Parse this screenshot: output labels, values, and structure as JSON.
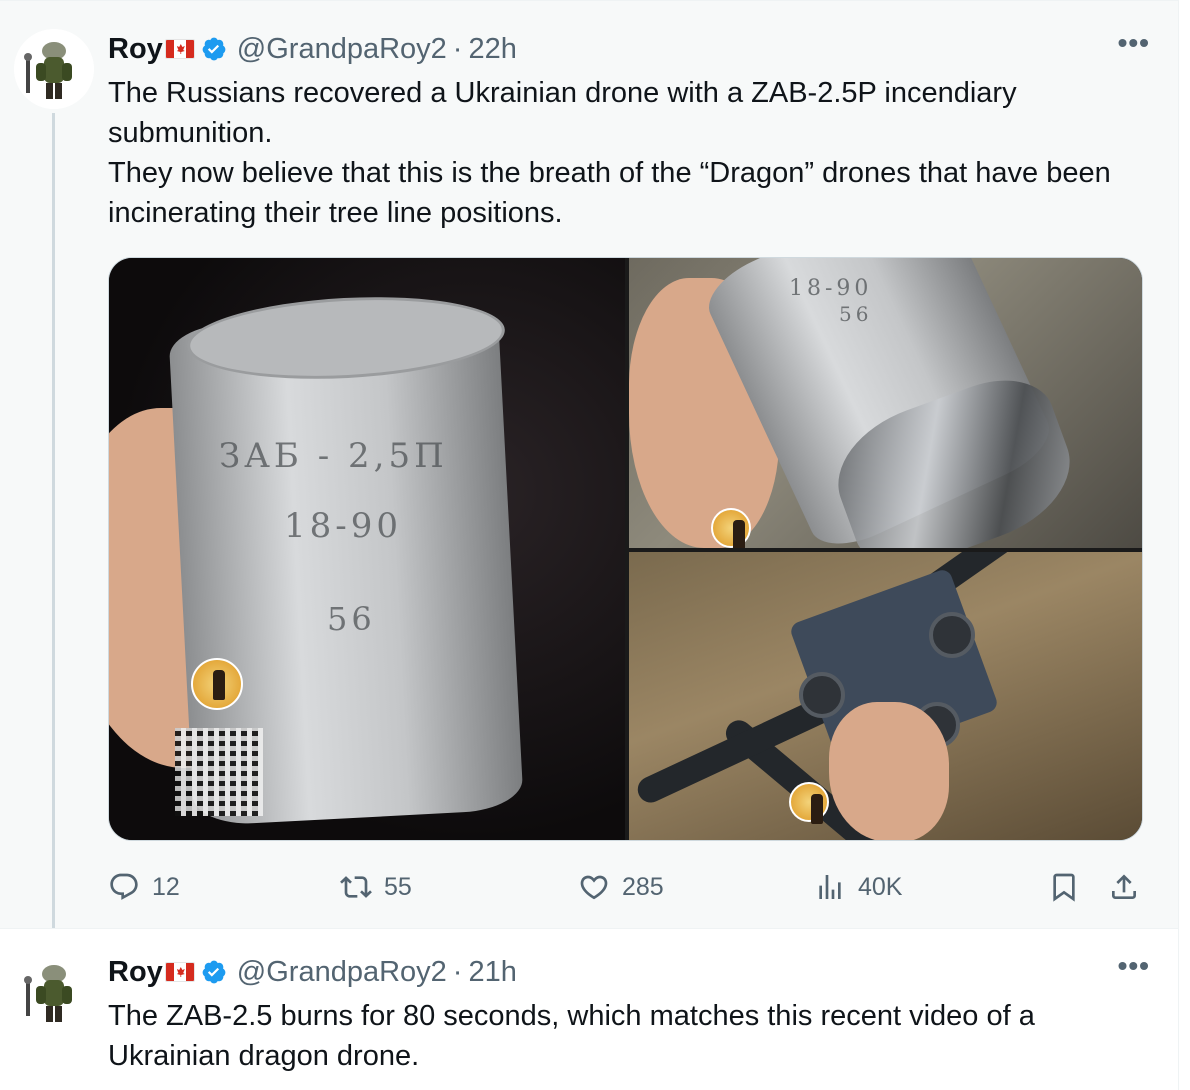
{
  "tweets": [
    {
      "author": {
        "name": "Roy",
        "handle": "@GrandpaRoy2",
        "flag_icon": "canada-flag-icon",
        "verified_icon": "verified-badge-icon",
        "verified_color": "#1d9bf0"
      },
      "separator": "·",
      "time": "22h",
      "more_label": "•••",
      "text_lines": [
        "The Russians recovered a Ukrainian drone with a ZAB-2.5P incendiary submunition.",
        "They now believe that this is the breath of the “Dragon” drones that have been incinerating their tree line positions."
      ],
      "media": {
        "left_stencil": [
          "ЗАБ - 2,5П",
          "18-90",
          "56"
        ],
        "top_right_stencil": [
          "18-90",
          "56"
        ]
      },
      "actions": {
        "replies": "12",
        "retweets": "55",
        "likes": "285",
        "views": "40K"
      }
    },
    {
      "author": {
        "name": "Roy",
        "handle": "@GrandpaRoy2",
        "flag_icon": "canada-flag-icon",
        "verified_icon": "verified-badge-icon",
        "verified_color": "#1d9bf0"
      },
      "separator": "·",
      "time": "21h",
      "more_label": "•••",
      "text_lines": [
        "The ZAB-2.5 burns for 80 seconds, which matches this recent video of a Ukrainian dragon drone."
      ]
    }
  ],
  "colors": {
    "text_primary": "#0f1419",
    "text_secondary": "#536471",
    "background_highlight": "#f7f9f9",
    "canada_red": "#d52b1e"
  }
}
